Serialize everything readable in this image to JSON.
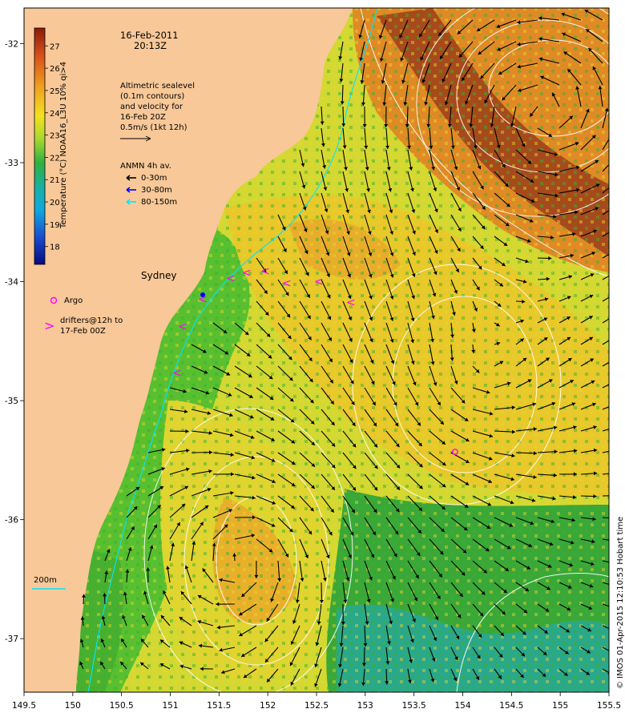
{
  "map": {
    "date": "16-Feb-2011",
    "time": "20:13Z",
    "place_label": "Sydney",
    "annotation_lines": [
      "Altimetric sealevel",
      "(0.1m contours)",
      "and velocity for",
      "16-Feb 20Z",
      "0.5m/s (1kt 12h)"
    ],
    "anmn_title": "ANMN 4h av.",
    "anmn_legend": [
      {
        "label": "0-30m",
        "color": "#000000"
      },
      {
        "label": "30-80m",
        "color": "#0000ff"
      },
      {
        "label": "80-150m",
        "color": "#00e5ff"
      }
    ],
    "argo_label": "Argo",
    "drifters_label_lines": [
      "drifters@12h to",
      "17-Feb 00Z"
    ],
    "isobath_label": "200m",
    "credit": "© IMOS 01-Apr-2015 12:10:53 Hobart time",
    "colorbar": {
      "title": "Temperature (°C) NOAA16_L3U 10% qi>4",
      "ticks": [
        "27",
        "26",
        "25",
        "24",
        "23",
        "22",
        "21",
        "20",
        "19",
        "18"
      ],
      "min": 17.2,
      "max": 27.8
    },
    "lon_ticks": [
      "149.5",
      "150",
      "150.5",
      "151",
      "151.5",
      "152",
      "152.5",
      "153",
      "153.5",
      "154",
      "154.5",
      "155",
      "155.5"
    ],
    "lat_ticks": [
      "-32",
      "-33",
      "-34",
      "-35",
      "-36",
      "-37"
    ],
    "lon_range": [
      149.5,
      155.5
    ],
    "lat_range": [
      -31.7,
      -37.45
    ],
    "colors": {
      "land": "#f8c898",
      "warm_core": "#a64a1c",
      "warm": "#e08a26",
      "mid": "#e8d02a",
      "cool": "#58c030",
      "cold": "#2aa88a",
      "contour": "#ffffff",
      "drifter": "#ff00ff",
      "isobath": "#00e5ff"
    }
  }
}
